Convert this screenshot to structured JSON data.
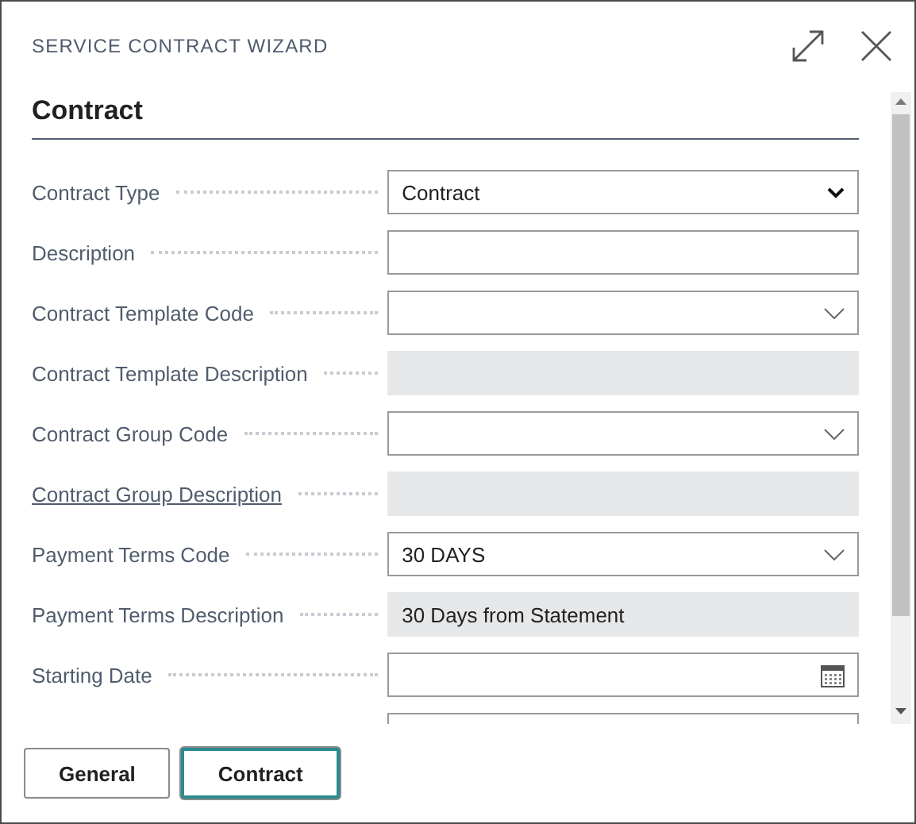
{
  "window": {
    "title": "SERVICE CONTRACT WIZARD"
  },
  "section": {
    "title": "Contract"
  },
  "fields": [
    {
      "label": "Contract Type",
      "kind": "select",
      "value": "Contract",
      "link": false
    },
    {
      "label": "Description",
      "kind": "text",
      "link": false
    },
    {
      "label": "Contract Template Code",
      "kind": "lookup",
      "link": false
    },
    {
      "label": "Contract Template Description",
      "kind": "readonly",
      "link": false
    },
    {
      "label": "Contract Group Code",
      "kind": "lookup",
      "link": false
    },
    {
      "label": "Contract Group Description",
      "kind": "readonly",
      "link": true
    },
    {
      "label": "Payment Terms Code",
      "kind": "lookup",
      "value": "30 DAYS",
      "link": false
    },
    {
      "label": "Payment Terms Description",
      "kind": "readonly",
      "value": "30 Days from Statement",
      "link": false
    },
    {
      "label": "Starting Date",
      "kind": "date",
      "link": false
    },
    {
      "kind": "cut"
    }
  ],
  "buttons": [
    {
      "label": "General",
      "selected": false
    },
    {
      "label": "Contract",
      "selected": true
    }
  ]
}
